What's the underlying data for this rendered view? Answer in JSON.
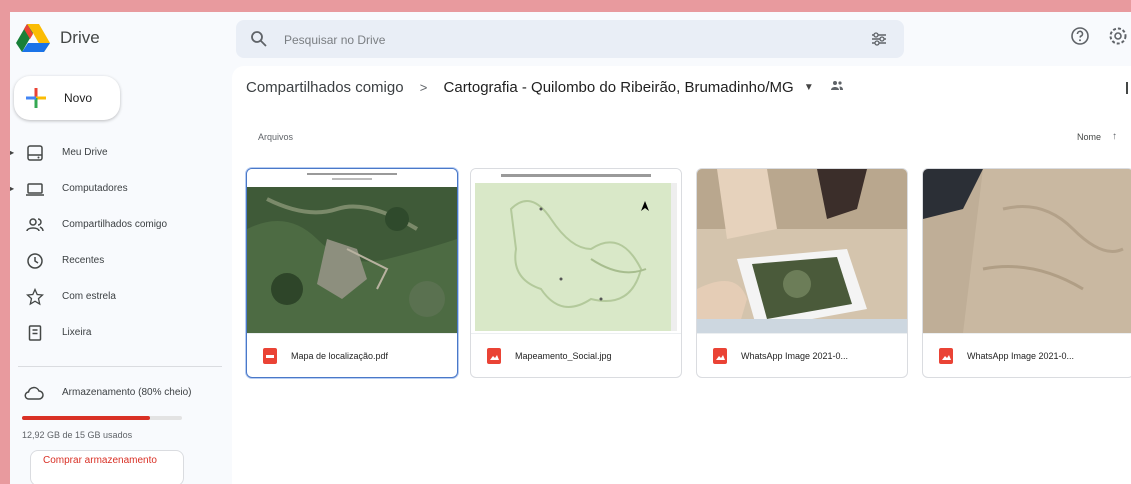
{
  "header": {
    "app_name": "Drive",
    "search_placeholder": "Pesquisar no Drive"
  },
  "sidebar": {
    "new_label": "Novo",
    "items": [
      {
        "label": "Meu Drive",
        "icon": "my-drive-icon"
      },
      {
        "label": "Computadores",
        "icon": "computer-icon"
      },
      {
        "label": "Compartilhados comigo",
        "icon": "shared-with-me-icon"
      },
      {
        "label": "Recentes",
        "icon": "clock-icon"
      },
      {
        "label": "Com estrela",
        "icon": "star-icon"
      },
      {
        "label": "Lixeira",
        "icon": "trash-icon"
      }
    ],
    "storage_label": "Armazenamento (80% cheio)",
    "storage_fraction": 0.8,
    "storage_text": "12,92 GB de 15 GB usados",
    "buy_label": "Comprar armazenamento"
  },
  "main": {
    "breadcrumb_parent": "Compartilhados comigo",
    "breadcrumb_sep": ">",
    "breadcrumb_current": "Cartografia - Quilombo do Ribeirão, Brumadinho/MG",
    "section_label": "Arquivos",
    "sort_label": "Nome",
    "files": [
      {
        "name": "Mapa de localização.pdf",
        "type": "pdf-icon"
      },
      {
        "name": "Mapeamento_Social.jpg",
        "type": "image-icon"
      },
      {
        "name": "WhatsApp Image 2021-0...",
        "type": "image-icon"
      },
      {
        "name": "WhatsApp Image 2021-0...",
        "type": "image-icon"
      }
    ]
  },
  "colors": {
    "accent_red": "#d93025",
    "selected_border": "#4a78c8",
    "background_frame": "#e89a9e"
  }
}
